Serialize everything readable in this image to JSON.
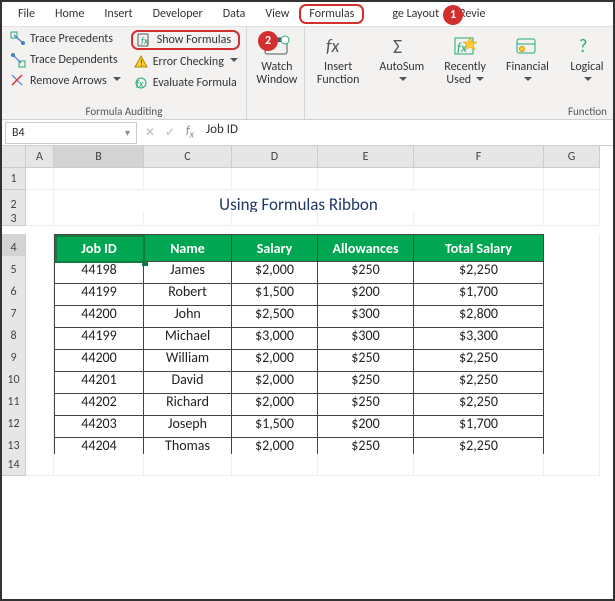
{
  "tabs": [
    "File",
    "Home",
    "Insert",
    "Developer",
    "Data",
    "View",
    "Formulas",
    "Page Layout",
    "Review"
  ],
  "active_tab": "Formulas",
  "ribbon": {
    "formula_auditing_label": "Formula Auditing",
    "trace_precedents": "Trace Precedents",
    "trace_dependents": "Trace Dependents",
    "remove_arrows": "Remove Arrows",
    "show_formulas": "Show Formulas",
    "error_checking": "Error Checking",
    "evaluate_formula": "Evaluate Formula",
    "watch_window": "Watch Window",
    "insert_function": "Insert Function",
    "autosum": "AutoSum",
    "recently_used": "Recently Used",
    "financial": "Financial",
    "logical": "Logical",
    "function_label": "Function"
  },
  "callouts": {
    "one": "1",
    "two": "2"
  },
  "namebox": "B4",
  "formula_value": "Job ID",
  "cols": [
    "A",
    "B",
    "C",
    "D",
    "E",
    "F",
    "G"
  ],
  "rows": [
    "1",
    "2",
    "3",
    "4",
    "5",
    "6",
    "7",
    "8",
    "9",
    "10",
    "11",
    "12",
    "13",
    "14"
  ],
  "title": "Using Formulas Ribbon",
  "headers": [
    "Job ID",
    "Name",
    "Salary",
    "Allowances",
    "Total Salary"
  ],
  "data": [
    {
      "id": "44198",
      "name": "James",
      "salary": "$2,000",
      "allow": "$250",
      "total": "$2,250"
    },
    {
      "id": "44199",
      "name": "Robert",
      "salary": "$1,500",
      "allow": "$200",
      "total": "$1,700"
    },
    {
      "id": "44200",
      "name": "John",
      "salary": "$2,500",
      "allow": "$300",
      "total": "$2,800"
    },
    {
      "id": "44199",
      "name": "Michael",
      "salary": "$3,000",
      "allow": "$300",
      "total": "$3,300"
    },
    {
      "id": "44200",
      "name": "William",
      "salary": "$2,000",
      "allow": "$250",
      "total": "$2,250"
    },
    {
      "id": "44201",
      "name": "David",
      "salary": "$2,000",
      "allow": "$250",
      "total": "$2,250"
    },
    {
      "id": "44202",
      "name": "Richard",
      "salary": "$2,000",
      "allow": "$250",
      "total": "$2,250"
    },
    {
      "id": "44203",
      "name": "Joseph",
      "salary": "$1,500",
      "allow": "$200",
      "total": "$1,700"
    },
    {
      "id": "44204",
      "name": "Thomas",
      "salary": "$2,000",
      "allow": "$250",
      "total": "$2,250"
    }
  ]
}
